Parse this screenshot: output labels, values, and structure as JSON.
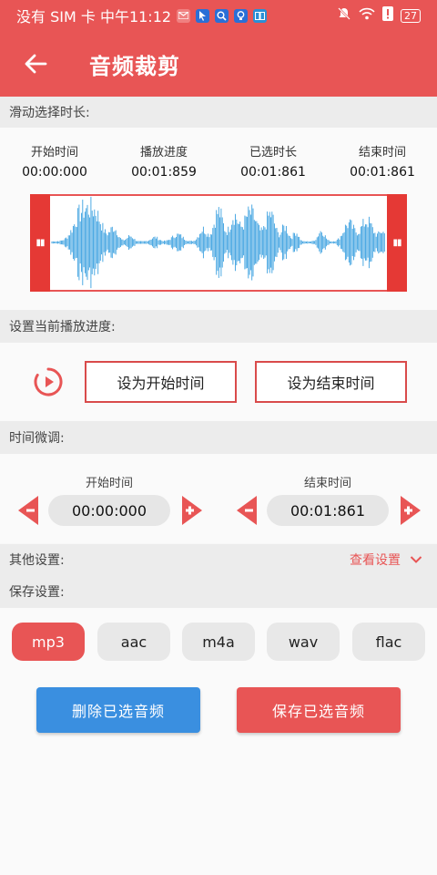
{
  "status_bar": {
    "carrier": "没有 SIM 卡 中午11:12",
    "battery": "27"
  },
  "header": {
    "title": "音频裁剪"
  },
  "duration_section": {
    "title": "滑动选择时长:",
    "columns": [
      {
        "label": "开始时间",
        "value": "00:00:000"
      },
      {
        "label": "播放进度",
        "value": "00:01:859"
      },
      {
        "label": "已选时长",
        "value": "00:01:861"
      },
      {
        "label": "结束时间",
        "value": "00:01:861"
      }
    ]
  },
  "progress_section": {
    "title": "设置当前播放进度:",
    "set_start_label": "设为开始时间",
    "set_end_label": "设为结束时间"
  },
  "tune_section": {
    "title": "时间微调:",
    "start_label": "开始时间",
    "start_value": "00:00:000",
    "end_label": "结束时间",
    "end_value": "00:01:861"
  },
  "other_section": {
    "title": "其他设置:",
    "view_label": "查看设置"
  },
  "save_section": {
    "title": "保存设置:",
    "formats": [
      "mp3",
      "aac",
      "m4a",
      "wav",
      "flac"
    ],
    "selected_format": "mp3"
  },
  "actions": {
    "delete_label": "删除已选音频",
    "save_label": "保存已选音频"
  },
  "colors": {
    "primary": "#e85555",
    "waveform": "#3aa0e0",
    "delete_button": "#3a8fe0"
  }
}
